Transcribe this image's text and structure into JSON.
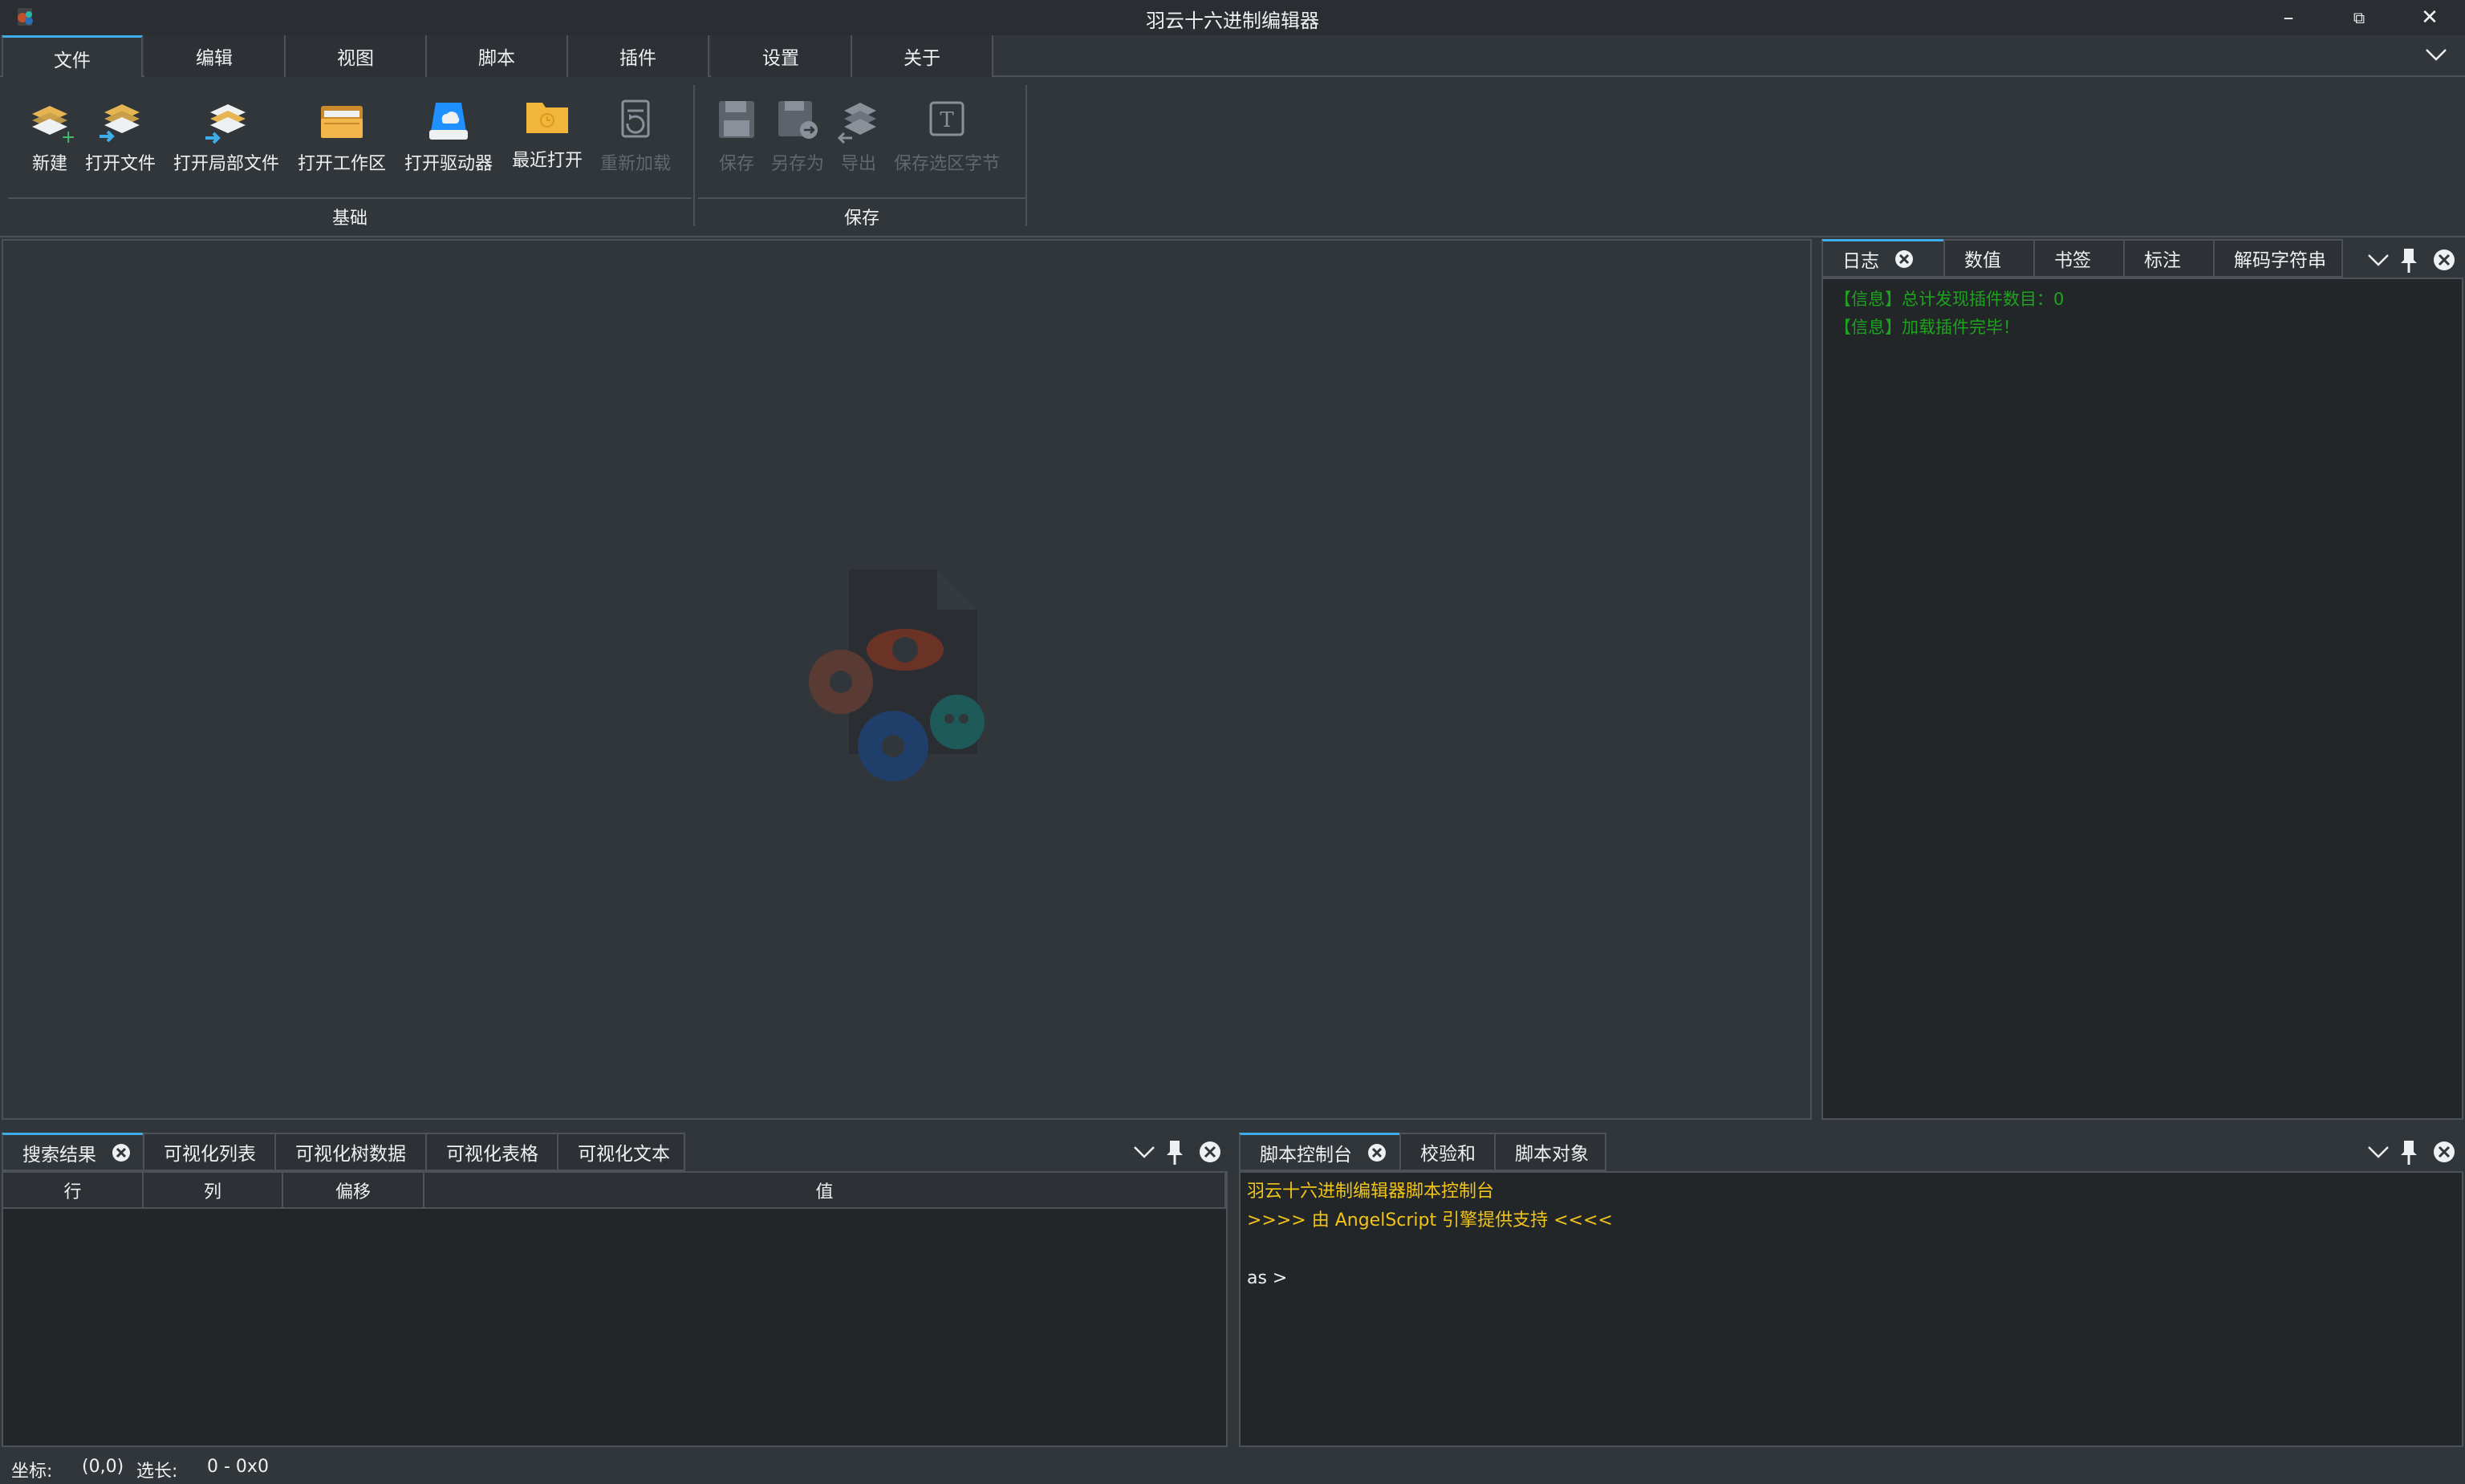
{
  "window": {
    "title": "羽云十六进制编辑器",
    "minimize_glyph": "–",
    "restore_glyph": "⧉",
    "close_glyph": "✕"
  },
  "ribbon": {
    "tabs": [
      {
        "label": "文件",
        "active": true
      },
      {
        "label": "编辑"
      },
      {
        "label": "视图"
      },
      {
        "label": "脚本"
      },
      {
        "label": "插件"
      },
      {
        "label": "设置"
      },
      {
        "label": "关于"
      }
    ],
    "groups": [
      {
        "label": "基础",
        "buttons": [
          {
            "label": "新建",
            "icon": "new-file-icon",
            "enabled": true
          },
          {
            "label": "打开文件",
            "icon": "open-file-icon",
            "enabled": true
          },
          {
            "label": "打开局部文件",
            "icon": "open-region-file-icon",
            "enabled": true
          },
          {
            "label": "打开工作区",
            "icon": "open-workspace-icon",
            "enabled": true
          },
          {
            "label": "打开驱动器",
            "icon": "open-drive-icon",
            "enabled": true
          },
          {
            "label": "最近打开",
            "icon": "recent-folder-icon",
            "enabled": true
          },
          {
            "label": "重新加载",
            "icon": "reload-icon",
            "enabled": false
          }
        ]
      },
      {
        "label": "保存",
        "buttons": [
          {
            "label": "保存",
            "icon": "save-icon",
            "enabled": false
          },
          {
            "label": "另存为",
            "icon": "save-as-icon",
            "enabled": false
          },
          {
            "label": "导出",
            "icon": "export-icon",
            "enabled": false
          },
          {
            "label": "保存选区字节",
            "icon": "save-selection-icon",
            "enabled": false
          }
        ]
      }
    ]
  },
  "right_dock": {
    "tabs": [
      {
        "label": "日志",
        "active": true,
        "closable": true
      },
      {
        "label": "数值"
      },
      {
        "label": "书签"
      },
      {
        "label": "标注"
      },
      {
        "label": "解码字符串"
      }
    ],
    "log_lines": [
      "【信息】总计发现插件数目：0",
      "【信息】加载插件完毕！"
    ]
  },
  "bottom_left_dock": {
    "tabs": [
      {
        "label": "搜索结果",
        "active": true,
        "closable": true
      },
      {
        "label": "可视化列表"
      },
      {
        "label": "可视化树数据"
      },
      {
        "label": "可视化表格"
      },
      {
        "label": "可视化文本"
      }
    ],
    "columns": [
      "行",
      "列",
      "偏移",
      "值"
    ]
  },
  "bottom_right_dock": {
    "tabs": [
      {
        "label": "脚本控制台",
        "active": true,
        "closable": true
      },
      {
        "label": "校验和"
      },
      {
        "label": "脚本对象"
      }
    ],
    "console_lines": [
      {
        "text": "羽云十六进制编辑器脚本控制台",
        "color": "#f0c419"
      },
      {
        "text": ">>>> 由 AngelScript 引擎提供支持 <<<<",
        "color": "#f0c419"
      },
      {
        "text": "",
        "color": "#eff0f1"
      },
      {
        "text": "as >",
        "color": "#eff0f1"
      }
    ]
  },
  "status_bar": {
    "coord_label": "坐标:",
    "coord_value": "(0,0)",
    "sel_label": "选长:",
    "sel_value": "0 - 0x0"
  },
  "colors": {
    "accent": "#3daee9",
    "log_text": "#1ea31e",
    "console_highlight": "#f0c419"
  }
}
